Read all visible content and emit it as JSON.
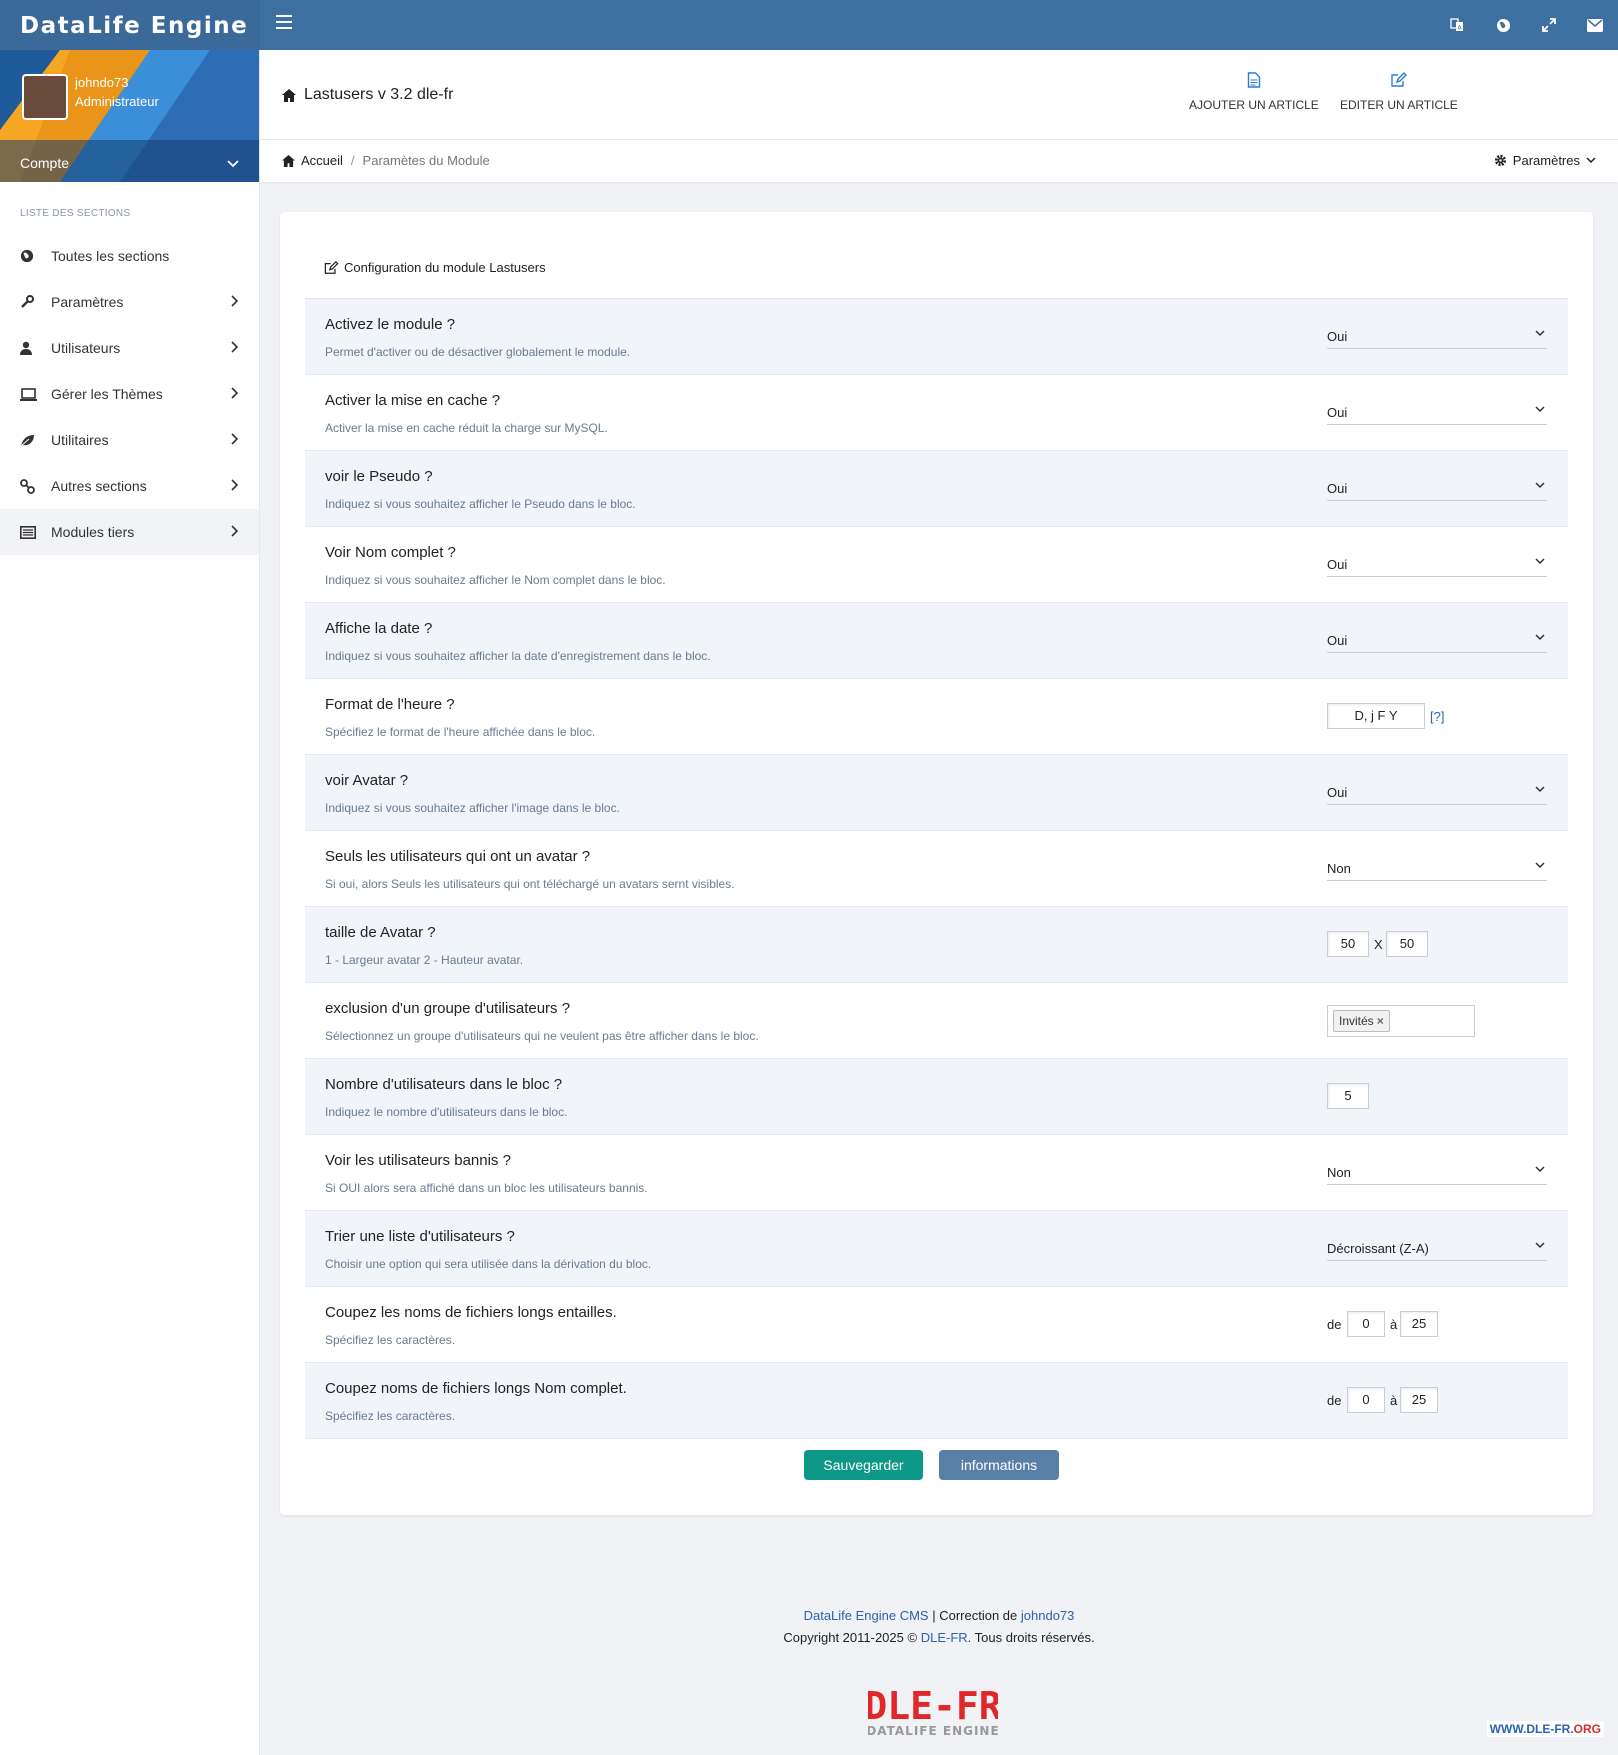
{
  "app": {
    "brand": "DataLife Engine"
  },
  "topbar": {
    "icons": [
      "menu-icon",
      "translate-icon",
      "globe-icon",
      "expand-icon",
      "envelope-icon"
    ]
  },
  "sidebar": {
    "user": {
      "name": "johndo73",
      "role": "Administrateur",
      "account_label": "Compte"
    },
    "section_heading": "LISTE DES SECTIONS",
    "items": [
      {
        "label": "Toutes les sections",
        "icon": "globe-icon"
      },
      {
        "label": "Paramètres",
        "icon": "wrench-icon"
      },
      {
        "label": "Utilisateurs",
        "icon": "user-icon"
      },
      {
        "label": "Gérer les Thèmes",
        "icon": "laptop-icon"
      },
      {
        "label": "Utilitaires",
        "icon": "leaf-icon"
      },
      {
        "label": "Autres sections",
        "icon": "link-icon"
      },
      {
        "label": "Modules tiers",
        "icon": "list-icon"
      }
    ]
  },
  "header": {
    "title": "Lastusers v 3.2 dle-fr",
    "actions": {
      "add_article": "AJOUTER UN ARTICLE",
      "edit_article": "EDITER UN ARTICLE"
    }
  },
  "breadcrumb": {
    "home": "Accueil",
    "separator": "/",
    "current": "Paramètes du Module",
    "settings": "Paramètres"
  },
  "card": {
    "title": "Configuration du module Lastusers",
    "rows": {
      "module": {
        "label": "Activez le module ?",
        "desc": "Permet d'activer ou de désactiver globalement le module.",
        "value": "Oui"
      },
      "cache": {
        "label": "Activer la mise en cache ?",
        "desc": "Activer la mise en cache réduit la charge sur MySQL.",
        "value": "Oui"
      },
      "pseudo": {
        "label": "voir le Pseudo ?",
        "desc": "Indiquez si vous souhaitez afficher le Pseudo dans le bloc.",
        "value": "Oui"
      },
      "fullname": {
        "label": "Voir Nom complet ?",
        "desc": "Indiquez si vous souhaitez afficher le Nom complet dans le bloc.",
        "value": "Oui"
      },
      "date": {
        "label": "Affiche la date ?",
        "desc": "Indiquez si vous souhaitez afficher la date d'enregistrement dans le bloc.",
        "value": "Oui"
      },
      "timeformat": {
        "label": "Format de l'heure ?",
        "desc": "Spécifiez le format de l'heure affichée dans le bloc.",
        "value": "D, j F Y",
        "help": "[?]"
      },
      "avatar": {
        "label": "voir Avatar ?",
        "desc": "Indiquez si vous souhaitez afficher l'image dans le bloc.",
        "value": "Oui"
      },
      "only_avatar": {
        "label": "Seuls les utilisateurs qui ont un avatar ?",
        "desc": "Si oui, alors Seuls les utilisateurs qui ont téléchargé un avatars sernt visibles.",
        "value": "Non"
      },
      "avatar_size": {
        "label": "taille de Avatar ?",
        "desc": "1 - Largeur avatar 2 - Hauteur avatar.",
        "width": "50",
        "separator": "X",
        "height": "50"
      },
      "exclude_group": {
        "label": "exclusion d'un groupe d'utilisateurs ?",
        "desc": "Sélectionnez un groupe d'utilisateurs qui ne veulent pas être afficher dans le bloc.",
        "tag": "Invités",
        "tag_remove": "×"
      },
      "count": {
        "label": "Nombre d'utilisateurs dans le bloc ?",
        "desc": "Indiquez le nombre d'utilisateurs dans le bloc.",
        "value": "5"
      },
      "banned": {
        "label": "Voir les utilisateurs bannis ?",
        "desc": "Si OUI alors sera affiché dans un bloc les utilisateurs bannis.",
        "value": "Non"
      },
      "sort": {
        "label": "Trier une liste d'utilisateurs ?",
        "desc": "Choisir une option qui sera utilisée dans la dérivation du bloc.",
        "value": "Décroissant (Z-A)"
      },
      "cut_names": {
        "label": "Coupez les noms de fichiers longs entailles.",
        "desc": "Spécifiez les caractères.",
        "from_label": "de",
        "from": "0",
        "to_label": "à",
        "to": "25"
      },
      "cut_fullname": {
        "label": "Coupez noms de fichiers longs Nom complet.",
        "desc": "Spécifiez les caractères.",
        "from_label": "de",
        "from": "0",
        "to_label": "à",
        "to": "25"
      }
    },
    "buttons": {
      "save": "Sauvegarder",
      "info": "informations"
    }
  },
  "footer": {
    "cms_link": "DataLife Engine CMS",
    "correction": "| Correction de",
    "author": "johndo73",
    "copyright": "Copyright 2011-2025 ©",
    "site": "DLE-FR",
    "rights": ". Tous droits réservés.",
    "logo_text": "DLE-FR",
    "logo_sub": "DATALIFE ENGINE",
    "watermark_a": "WWW.DLE-FR.",
    "watermark_b": "ORG"
  },
  "colors": {
    "topbar": "#3e6fa1",
    "save": "#0d9888",
    "info": "#5a7fa6",
    "link": "#2a62b0",
    "logo": "#e02828"
  }
}
